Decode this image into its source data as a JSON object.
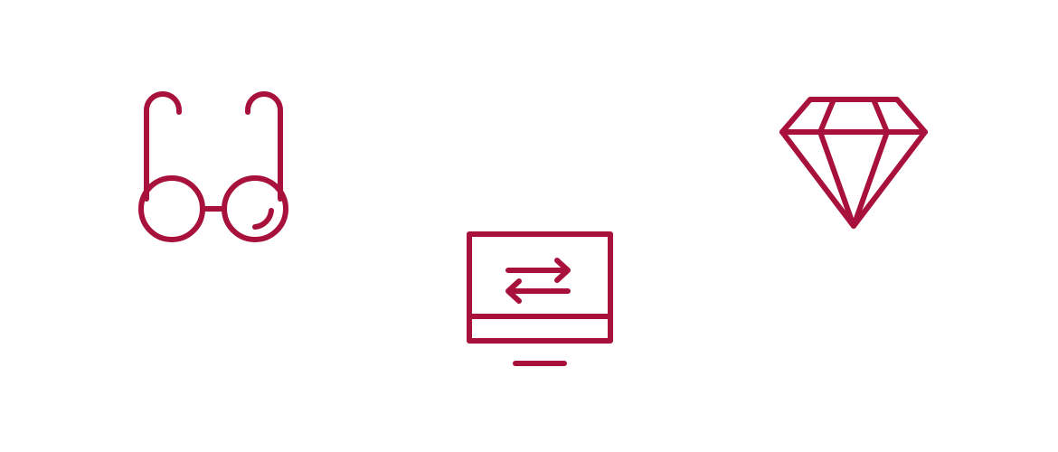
{
  "colors": {
    "background": "#ffffff",
    "icon_stroke": "#a8113b"
  },
  "icons": [
    {
      "key": "glasses",
      "semantic": "eyeglasses-icon"
    },
    {
      "key": "monitor",
      "semantic": "monitor-transfer-icon"
    },
    {
      "key": "diamond",
      "semantic": "diamond-icon"
    }
  ]
}
